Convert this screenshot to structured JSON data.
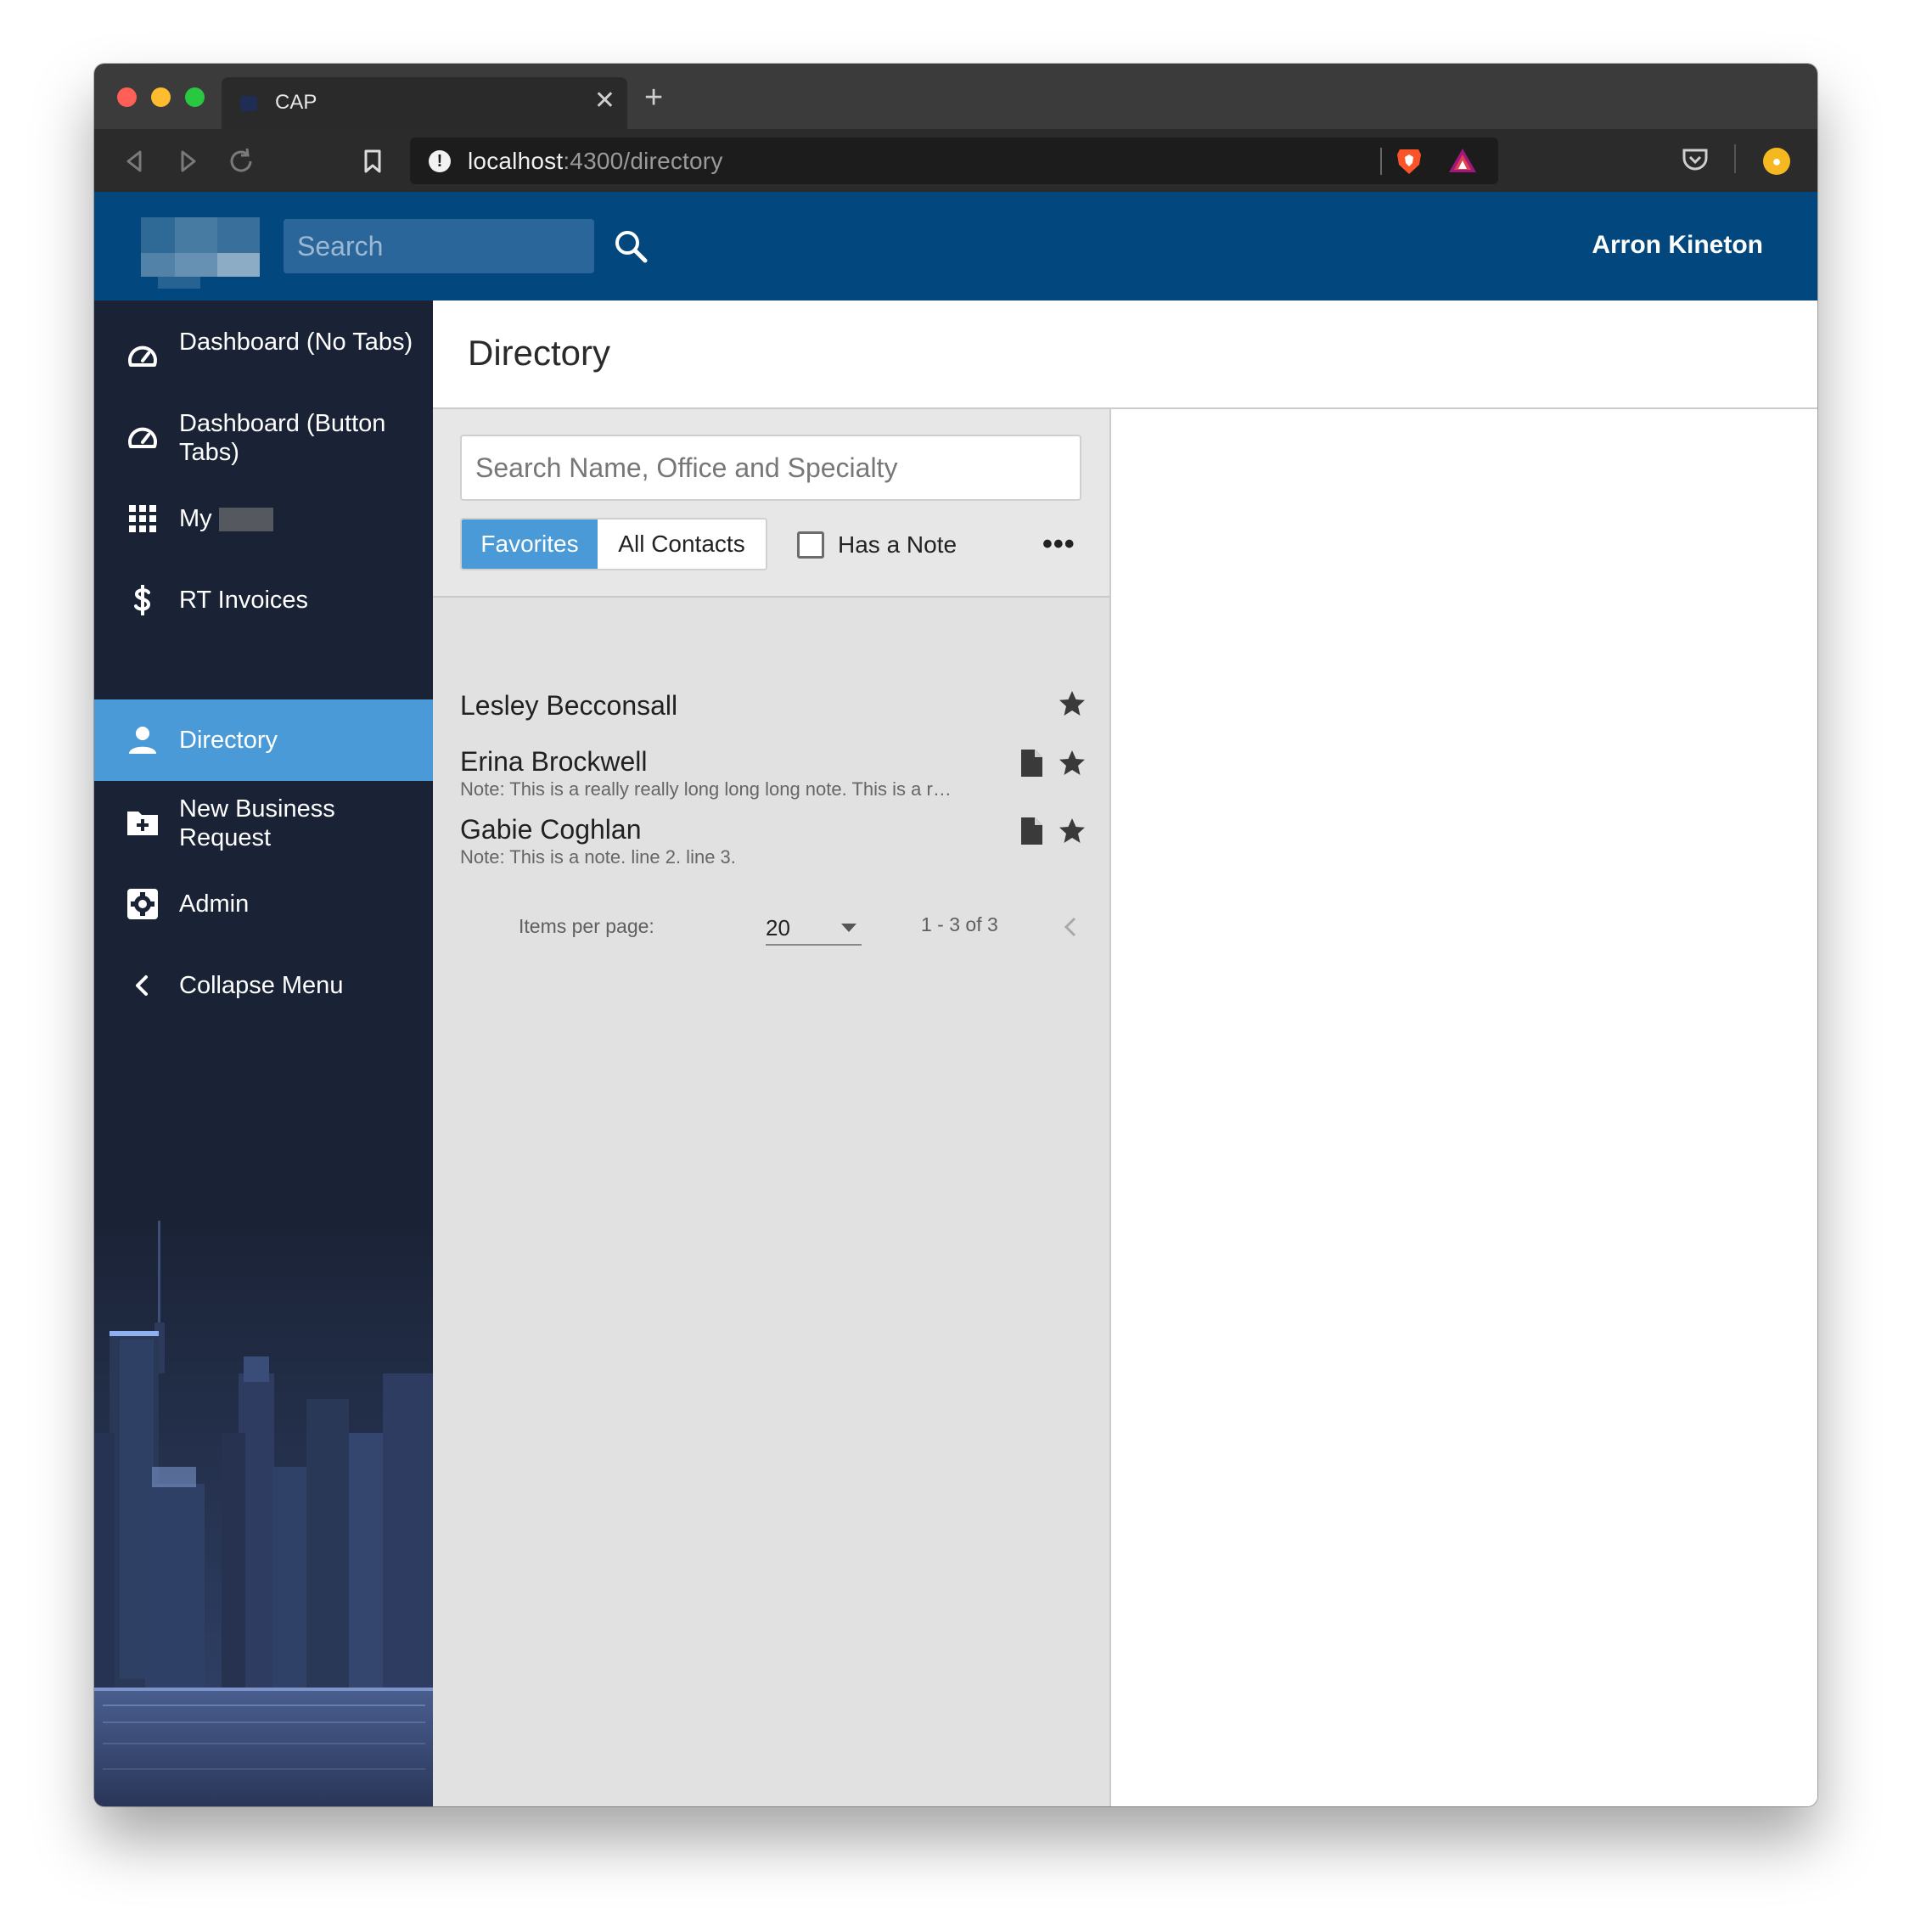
{
  "browser": {
    "tab_title": "CAP",
    "tab_close": "✕",
    "new_tab": "+",
    "url_host": "localhost",
    "url_rest": ":4300/directory"
  },
  "header": {
    "search_placeholder": "Search",
    "user_name": "Arron Kineton",
    "color": "#02487f"
  },
  "sidebar": {
    "items": [
      {
        "label": "Dashboard (No Tabs)",
        "icon": "speedometer-icon"
      },
      {
        "label": "Dashboard (Button Tabs)",
        "icon": "speedometer-icon"
      },
      {
        "label": "My",
        "icon": "grid-icon"
      },
      {
        "label": "RT Invoices",
        "icon": "dollar-icon"
      },
      {
        "label": "Directory",
        "icon": "person-icon",
        "active": true
      },
      {
        "label": "New Business Request",
        "icon": "folder-plus-icon"
      },
      {
        "label": "Admin",
        "icon": "gear-icon"
      },
      {
        "label": "Collapse Menu",
        "icon": "chevron-left-icon"
      }
    ],
    "active_color": "#4a9ad8"
  },
  "page": {
    "title": "Directory"
  },
  "directory": {
    "search_placeholder": "Search Name, Office and Specialty",
    "toggle": {
      "favorites": "Favorites",
      "all": "All Contacts"
    },
    "has_note_label": "Has a Note",
    "more": "•••",
    "contacts": [
      {
        "name": "Lesley Becconsall",
        "note": "",
        "has_note": false,
        "favorite": true
      },
      {
        "name": "Erina Brockwell",
        "note": "Note: This is a really really long long long note. This is a really really long long long note.",
        "has_note": true,
        "favorite": true
      },
      {
        "name": "Gabie Coghlan",
        "note": "Note: This is a note. line 2. line 3.",
        "has_note": true,
        "favorite": true
      }
    ],
    "paginator": {
      "items_per_page_label": "Items per page:",
      "items_per_page": "20",
      "range": "1 - 3 of 3"
    }
  }
}
